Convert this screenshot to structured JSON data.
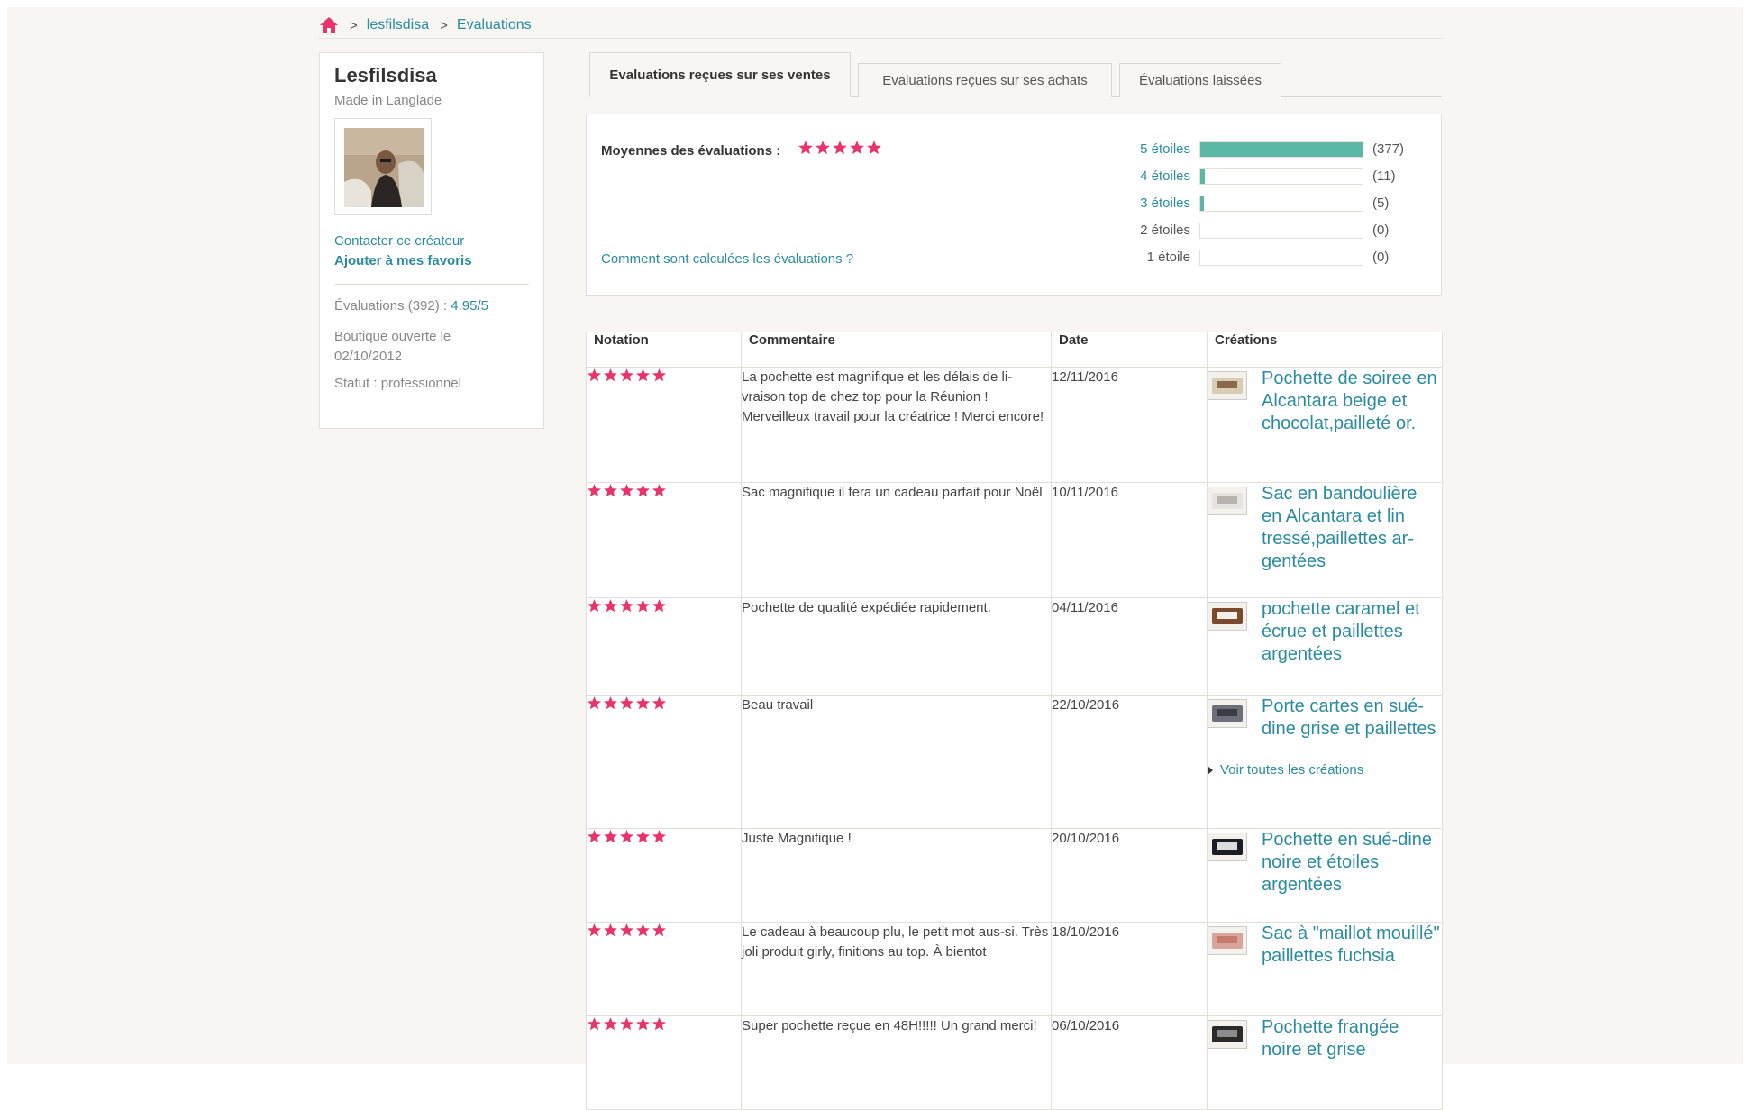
{
  "breadcrumb": {
    "items": [
      "lesfilsdisa",
      "Evaluations"
    ],
    "separator": ">"
  },
  "profile": {
    "name": "Lesfilsdisa",
    "location": "Made in Langlade",
    "contact_link": "Contacter ce créateur",
    "favorite_link": "Ajouter à mes favoris",
    "ratings_label": "Évaluations (392) :",
    "ratings_score": "4.95/5",
    "shop_opened_label": "Boutique ouverte le",
    "shop_opened_date": "02/10/2012",
    "status": "Statut : professionnel"
  },
  "tabs": [
    {
      "label": "Evaluations reçues sur ses ventes",
      "active": true
    },
    {
      "label": "Evaluations reçues sur ses achats",
      "active": false
    },
    {
      "label": "Évaluations laissées",
      "active": false
    }
  ],
  "summary": {
    "average_label": "Moyennes des évaluations :",
    "average_stars": 5,
    "calc_link": "Comment sont calculées les évaluations ?",
    "distribution": [
      {
        "label": "5 étoiles",
        "count_text": "(377)",
        "count": 377,
        "fill_fraction": 1.0
      },
      {
        "label": "4 étoiles",
        "count_text": "(11)",
        "count": 11,
        "fill_fraction": 0.03
      },
      {
        "label": "3 étoiles",
        "count_text": "(5)",
        "count": 5,
        "fill_fraction": 0.013
      },
      {
        "label": "2 étoiles",
        "count_text": "(0)",
        "count": 0,
        "fill_fraction": 0
      },
      {
        "label": "1 étoile",
        "count_text": "(0)",
        "count": 0,
        "fill_fraction": 0
      }
    ]
  },
  "table": {
    "headers": [
      "Notation",
      "Commentaire",
      "Date",
      "Créations"
    ],
    "more_link": "Voir toutes les créations",
    "rows": [
      {
        "stars": 5,
        "comment": "La pochette est magnifique et les délais de li-vraison top de chez top pour la Réunion ! Merveilleux travail pour la créatrice ! Merci encore!",
        "date": "12/11/2016",
        "creation": "Pochette de soiree en Alcantara beige et chocolat,pailleté or."
      },
      {
        "stars": 5,
        "comment": "Sac magnifique il fera un cadeau parfait pour Noël",
        "date": "10/11/2016",
        "creation": "Sac en bandoulière en Alcantara et lin tressé,paillettes ar-gentées"
      },
      {
        "stars": 5,
        "comment": "Pochette de qualité expédiée rapidement.",
        "date": "04/11/2016",
        "creation": "pochette caramel et écrue et paillettes argentées"
      },
      {
        "stars": 5,
        "comment": "Beau travail",
        "date": "22/10/2016",
        "creation": "Porte cartes en sué-dine grise et paillettes"
      },
      {
        "stars": 5,
        "comment": "Juste Magnifique !",
        "date": "20/10/2016",
        "creation": "Pochette en sué-dine noire et étoiles argentées"
      },
      {
        "stars": 5,
        "comment": "Le cadeau à beaucoup plu, le petit mot aus-si. Très joli produit girly, finitions au top. À bientot",
        "date": "18/10/2016",
        "creation": "Sac à \"maillot mouillé\" paillettes fuchsia"
      },
      {
        "stars": 5,
        "comment": "Super pochette reçue en 48H!!!!! Un grand merci!",
        "date": "06/10/2016",
        "creation": "Pochette frangée noire et grise"
      }
    ]
  },
  "colors": {
    "accent": "#2a8c9e",
    "star": "#e8336b",
    "bar": "#5bb8a6",
    "home": "#e8336b"
  }
}
